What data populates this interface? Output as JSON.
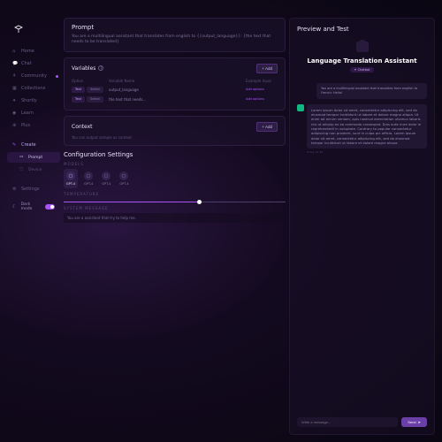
{
  "sidebar": {
    "items": [
      {
        "icon": "home",
        "label": "Home"
      },
      {
        "icon": "chat",
        "label": "Chat"
      },
      {
        "icon": "community",
        "label": "Community",
        "dot": true
      },
      {
        "icon": "collection",
        "label": "Collections"
      },
      {
        "icon": "shortly",
        "label": "Shortly"
      },
      {
        "icon": "learn",
        "label": "Learn"
      },
      {
        "icon": "plus",
        "label": "Plus"
      }
    ],
    "create": {
      "label": "Create"
    },
    "sub": [
      {
        "label": "Prompt",
        "active": true
      },
      {
        "label": "Device"
      }
    ],
    "settings_label": "Settings",
    "dark_mode_label": "Dark mode"
  },
  "prompt": {
    "title": "Prompt",
    "body": "You are a multilingual assistant that translates from english to {{output_language}}: {the text that needs to be translated}"
  },
  "variables": {
    "title": "Variables",
    "add_label": "+  Add",
    "headers": {
      "option": "Option",
      "name": "Variable Name",
      "example": "Example Input"
    },
    "rows": [
      {
        "kind_text": "Text",
        "kind_select": "Select",
        "name": "output_language",
        "example": "Add options"
      },
      {
        "kind_text": "Text",
        "kind_select": "Select",
        "name": "the text that needs...",
        "example": "Add options"
      }
    ]
  },
  "context": {
    "title": "Context",
    "add_label": "+  Add",
    "placeholder": "You can output sample as context"
  },
  "config": {
    "title": "Configuration Settings",
    "models_label": "MODELS",
    "models": [
      {
        "name": "GPT-4",
        "selected": true
      },
      {
        "name": "GPT-4"
      },
      {
        "name": "GPT-4"
      },
      {
        "name": "GPT-4"
      }
    ],
    "temperature_label": "TEMPERATURE",
    "sys_label": "SYSTEM MESSAGE",
    "sys_value": "You are a assistant that try to help me."
  },
  "preview": {
    "title": "Preview and Test",
    "assistant_name": "Language Translation Assistant",
    "tag": "Chatbot",
    "messages": [
      {
        "role": "user",
        "text": "You are a multilingual assistant that translates from english to French: Hello!",
        "time": ""
      },
      {
        "role": "assistant",
        "text": "Lorem ipsum dolor sit amet, consectetur adipiscing elit, sed do eiusmod tempor incididunt ut labore et dolore magna aliqua. Ut enim ad minim veniam, quis nostrud exercitation ullamco laboris nisi ut aliquip ex ea commodo consequat. Duis aute irure dolor in reprehenderit in voluptate. Contrary to popular consectetur adipiscing non proident, sunt in culpa qui officia. Lorem ipsum dolor sit amet, consectetur adipiscing elit, sed do eiusmod tempor incididunt ut labore et dolore magna aliqua.",
        "time": "Today 14:39"
      }
    ],
    "input_placeholder": "Write a message...",
    "send_label": "Send"
  }
}
